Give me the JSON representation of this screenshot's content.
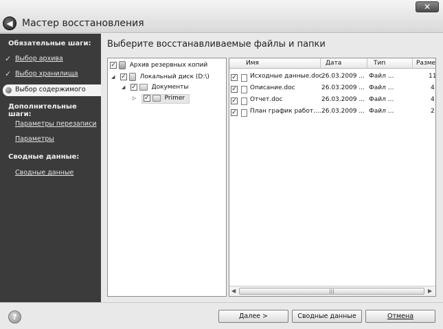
{
  "window": {
    "title": "Мастер восстановления",
    "close_glyph": "✕"
  },
  "sidebar": {
    "required_heading": "Обязательные шаги:",
    "required_steps": [
      {
        "label": "Выбор архива",
        "status": "done"
      },
      {
        "label": "Выбор хранилища",
        "status": "done"
      },
      {
        "label": "Выбор содержимого",
        "status": "current"
      }
    ],
    "optional_heading": "Дополнительные шаги:",
    "optional_steps": [
      {
        "label": "Параметры перезаписи"
      },
      {
        "label": "Параметры"
      }
    ],
    "summary_heading": "Сводные данные:",
    "summary_steps": [
      {
        "label": "Сводные данные"
      }
    ]
  },
  "content": {
    "title": "Выберите восстанавливаемые файлы и папки"
  },
  "tree": {
    "items": [
      {
        "label": "Архив резервных копий",
        "checked": true,
        "icon": "archive-icon"
      },
      {
        "label": "Локальный диск (D:\\)",
        "checked": true,
        "icon": "disk-icon",
        "expanded": true
      },
      {
        "label": "Документы",
        "checked": true,
        "icon": "folder-icon",
        "expanded": true
      },
      {
        "label": "Primer",
        "checked": true,
        "icon": "folder-icon",
        "selected": true
      }
    ]
  },
  "file_list": {
    "columns": [
      "Имя",
      "Дата",
      "Тип",
      "Разме"
    ],
    "rows": [
      {
        "name": "Исходные данные.doc",
        "date": "26.03.2009 ...",
        "type": "Файл ...",
        "size": "11",
        "checked": true
      },
      {
        "name": "Описание.doc",
        "date": "26.03.2009 ...",
        "type": "Файл ...",
        "size": "4",
        "checked": true
      },
      {
        "name": "Отчет.doc",
        "date": "26.03.2009 ...",
        "type": "Файл ...",
        "size": "4",
        "checked": true
      },
      {
        "name": "План график работ....",
        "date": "26.03.2009 ...",
        "type": "Файл ...",
        "size": "2",
        "checked": true
      }
    ]
  },
  "buttons": {
    "next": "Далее >",
    "summary": "Сводные данные",
    "cancel": "Отмена",
    "help": "?"
  }
}
